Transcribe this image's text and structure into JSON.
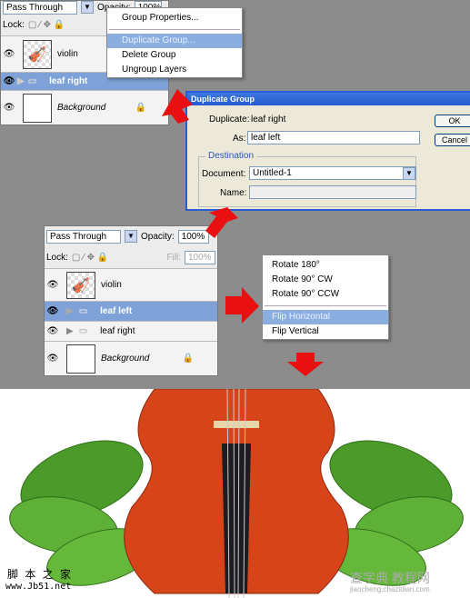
{
  "panel1": {
    "blend": "Pass Through",
    "opacity_label": "Opacity:",
    "opacity": "100%",
    "lock_label": "Lock:",
    "layers": [
      {
        "name": "violin"
      },
      {
        "name": "leaf right",
        "selected": true
      },
      {
        "name": "Background"
      }
    ]
  },
  "menu1": {
    "items": [
      "Group Properties...",
      "Duplicate Group...",
      "Delete Group",
      "Ungroup Layers"
    ],
    "highlighted": "Duplicate Group..."
  },
  "dialog": {
    "title": "Duplicate Group",
    "duplicate_label": "Duplicate:",
    "duplicate_value": "leaf right",
    "as_label": "As:",
    "as_value": "leaf left",
    "destination_label": "Destination",
    "document_label": "Document:",
    "document_value": "Untitled-1",
    "name_label": "Name:",
    "ok": "OK",
    "cancel": "Cancel"
  },
  "panel2": {
    "blend": "Pass Through",
    "opacity_label": "Opacity:",
    "opacity": "100%",
    "lock_label": "Lock:",
    "fill_label": "Fill:",
    "fill": "100%",
    "layers": [
      {
        "name": "violin"
      },
      {
        "name": "leaf left",
        "selected": true
      },
      {
        "name": "leaf right"
      },
      {
        "name": "Background"
      }
    ]
  },
  "menu2": {
    "items": [
      "Rotate 180°",
      "Rotate 90° CW",
      "Rotate 90° CCW",
      "Flip Horizontal",
      "Flip Vertical"
    ],
    "highlighted": "Flip Horizontal"
  },
  "watermarks": {
    "left_cn": "脚 本 之 家",
    "left_url": "www.Jb51.net",
    "right_cn": "查字典 教程网",
    "right_url": "jiaocheng.chazidian.com"
  },
  "colors": {
    "arrow": "#e81010",
    "highlight": "#7ea2d8",
    "background": "#8c8c8c"
  }
}
